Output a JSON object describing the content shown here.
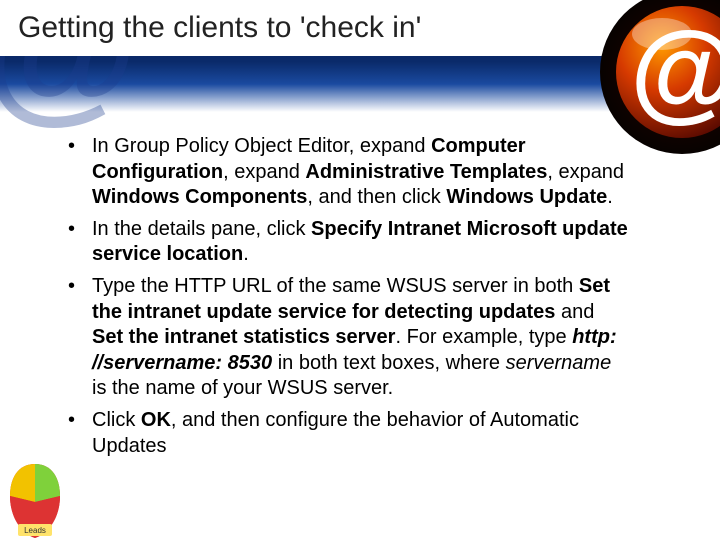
{
  "title": "Getting the clients to 'check in'",
  "bullets": [
    {
      "segments": [
        {
          "t": "In Group Policy Object Editor, expand "
        },
        {
          "t": "Computer Configuration",
          "bold": true
        },
        {
          "t": ", expand "
        },
        {
          "t": "Administrative Templates",
          "bold": true
        },
        {
          "t": ", expand "
        },
        {
          "t": "Windows Components",
          "bold": true
        },
        {
          "t": ", and then click "
        },
        {
          "t": "Windows Update",
          "bold": true
        },
        {
          "t": "."
        }
      ]
    },
    {
      "segments": [
        {
          "t": "In the details pane, click "
        },
        {
          "t": "Specify Intranet Microsoft update service location",
          "bold": true
        },
        {
          "t": "."
        }
      ]
    },
    {
      "segments": [
        {
          "t": "Type the HTTP URL of the same WSUS server in both "
        },
        {
          "t": "Set the intranet update service for detecting updates",
          "bold": true
        },
        {
          "t": " and "
        },
        {
          "t": "Set the intranet statistics server",
          "bold": true
        },
        {
          "t": ". For example, type "
        },
        {
          "t": "http: //servername: 8530",
          "bold": true,
          "italic": true
        },
        {
          "t": " in both text boxes, where "
        },
        {
          "t": "servername",
          "italic": true
        },
        {
          "t": " is the name of your WSUS server."
        }
      ]
    },
    {
      "segments": [
        {
          "t": "Click "
        },
        {
          "t": "OK",
          "bold": true
        },
        {
          "t": ", and then configure the behavior of Automatic Updates"
        }
      ]
    }
  ],
  "badge_label": "Leads"
}
